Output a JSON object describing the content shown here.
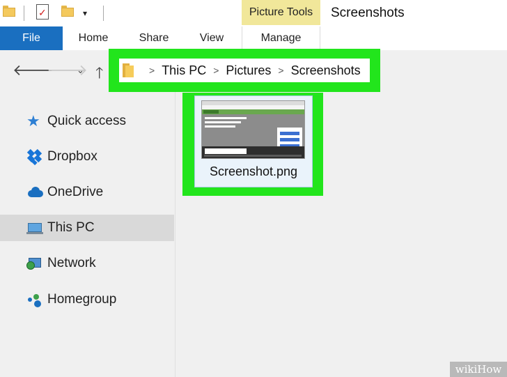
{
  "window": {
    "title": "Screenshots",
    "contextual_tab_group": "Picture Tools"
  },
  "ribbon": {
    "tabs": [
      {
        "label": "File"
      },
      {
        "label": "Home"
      },
      {
        "label": "Share"
      },
      {
        "label": "View"
      },
      {
        "label": "Manage"
      }
    ]
  },
  "address_bar": {
    "breadcrumbs": [
      "This PC",
      "Pictures",
      "Screenshots"
    ]
  },
  "nav_pane": {
    "items": [
      {
        "label": "Quick access",
        "icon": "star-icon"
      },
      {
        "label": "Dropbox",
        "icon": "dropbox-icon"
      },
      {
        "label": "OneDrive",
        "icon": "onedrive-icon"
      },
      {
        "label": "This PC",
        "icon": "computer-icon",
        "selected": true
      },
      {
        "label": "Network",
        "icon": "network-icon"
      },
      {
        "label": "Homegroup",
        "icon": "homegroup-icon"
      }
    ]
  },
  "files": [
    {
      "name": "Screenshot.png",
      "type": "image"
    }
  ],
  "watermark": "wikiHow",
  "colors": {
    "highlight": "#22e51c",
    "file_tab": "#1a6fc0",
    "picture_tools": "#f1e79a",
    "selected_nav": "#d9d9d9"
  }
}
